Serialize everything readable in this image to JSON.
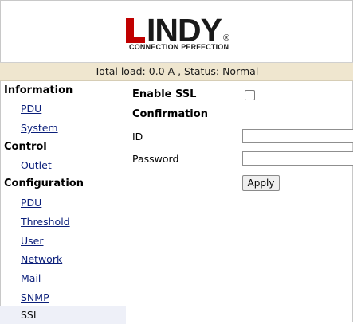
{
  "header": {
    "logo_letters": "INDY",
    "logo_reg": "®",
    "logo_tagline": "CONNECTION PERFECTION"
  },
  "status_bar": {
    "text": "Total load: 0.0 A , Status: Normal"
  },
  "sidebar": {
    "sections": [
      {
        "title": "Information",
        "items": [
          "PDU",
          "System"
        ]
      },
      {
        "title": "Control",
        "items": [
          "Outlet"
        ]
      },
      {
        "title": "Configuration",
        "items": [
          "PDU",
          "Threshold",
          "User",
          "Network",
          "Mail",
          "SNMP",
          "SSL"
        ]
      }
    ],
    "active_item": "SSL"
  },
  "form": {
    "enable_ssl_label": "Enable SSL",
    "enable_ssl_checked": false,
    "confirmation_label": "Confirmation",
    "id_label": "ID",
    "id_value": "",
    "password_label": "Password",
    "password_value": "",
    "apply_label": "Apply"
  },
  "colors": {
    "logo_red": "#c00000",
    "status_bar_bg": "#efe6cf",
    "link": "#0b1f7a",
    "active_bg": "#eef0f8"
  }
}
